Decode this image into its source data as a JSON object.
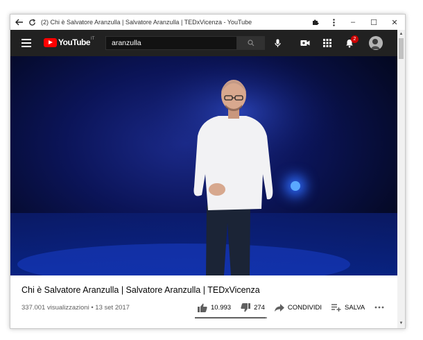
{
  "browser": {
    "tab_title": "(2) Chi è Salvatore Aranzulla | Salvatore Aranzulla | TEDxVicenza - YouTube",
    "minimize_glyph": "–",
    "maximize_glyph": "☐",
    "close_glyph": "✕"
  },
  "header": {
    "logo_text": "YouTube",
    "region": "IT",
    "search_value": "aranzulla",
    "notification_count": "2"
  },
  "video": {
    "title": "Chi è Salvatore Aranzulla | Salvatore Aranzulla | TEDxVicenza",
    "meta": "337.001 visualizzazioni • 13 set 2017",
    "likes": "10.993",
    "dislikes": "274",
    "share_label": "CONDIVIDI",
    "save_label": "SALVA",
    "like_fraction": 0.976
  },
  "colors": {
    "header_bg": "#212121",
    "brand_red": "#ff0000",
    "badge": "#cc0000"
  }
}
